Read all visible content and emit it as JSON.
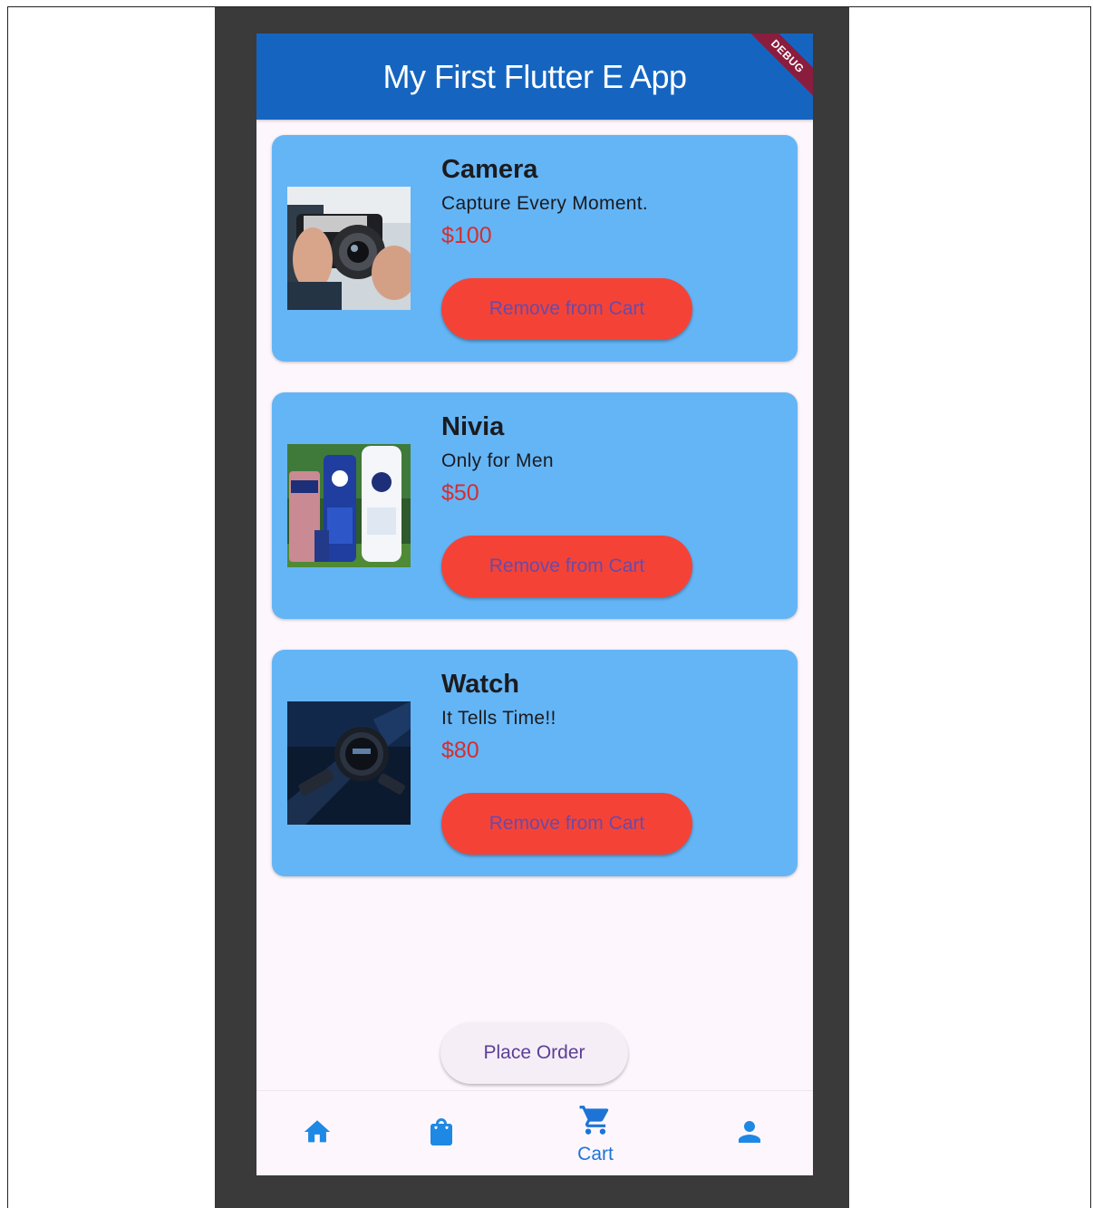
{
  "app": {
    "title": "My First Flutter E App",
    "debug_label": "DEBUG"
  },
  "colors": {
    "appbar": "#1565c0",
    "card": "#64b5f6",
    "button": "#f44336",
    "price": "#d32f2f",
    "nav_active": "#1e74d6"
  },
  "cart": {
    "items": [
      {
        "name": "Camera",
        "description": "Capture Every Moment.",
        "price": "$100",
        "button_label": "Remove from Cart",
        "image": "camera-photo"
      },
      {
        "name": "Nivia",
        "description": "Only for Men",
        "price": "$50",
        "button_label": "Remove from Cart",
        "image": "skincare-bottles-photo"
      },
      {
        "name": "Watch",
        "description": "It Tells Time!!",
        "price": "$80",
        "button_label": "Remove from Cart",
        "image": "wristwatch-photo"
      }
    ]
  },
  "place_order_label": "Place Order",
  "bottom_nav": {
    "items": [
      {
        "icon": "home-icon",
        "label": ""
      },
      {
        "icon": "shopping-bag-icon",
        "label": ""
      },
      {
        "icon": "cart-icon",
        "label": "Cart"
      },
      {
        "icon": "person-icon",
        "label": ""
      }
    ]
  }
}
